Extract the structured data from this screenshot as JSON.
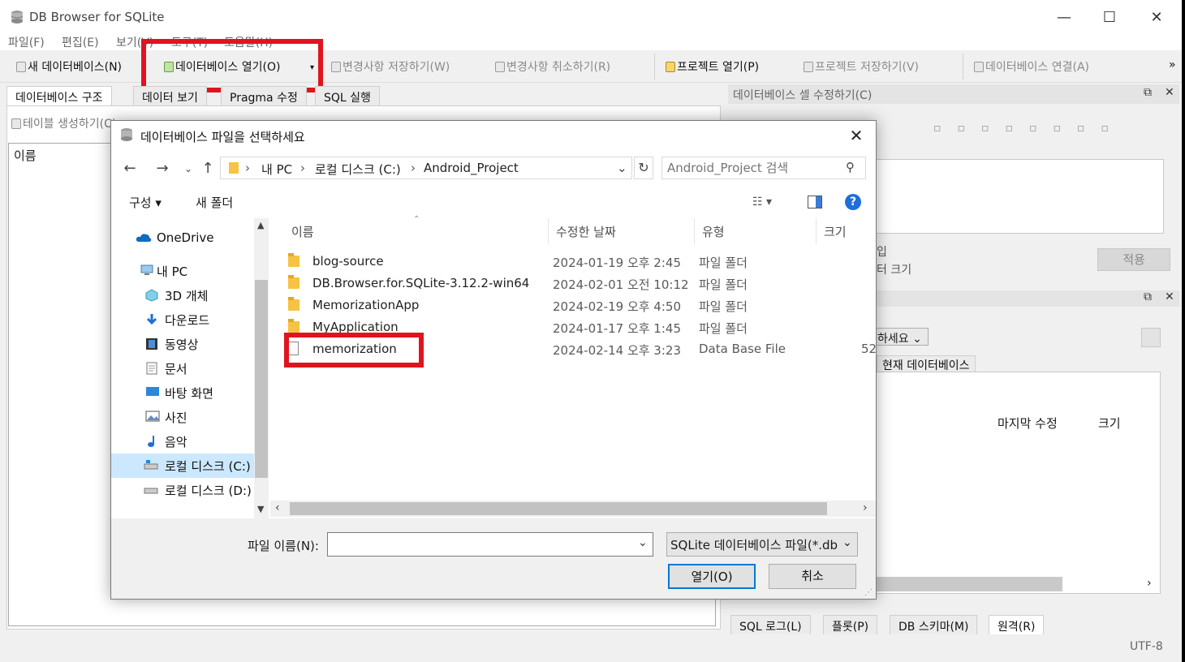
{
  "window": {
    "title": "DB Browser for SQLite",
    "minimize": "—",
    "maximize": "☐",
    "close": "✕"
  },
  "menu": [
    "파일(F)",
    "편집(E)",
    "보기(V)",
    "도구(T)",
    "도움말(H)"
  ],
  "toolbar": {
    "new_db": "새 데이터베이스(N)",
    "open_db": "데이터베이스 열기(O)",
    "write_changes": "변경사항 저장하기(W)",
    "revert_changes": "변경사항 취소하기(R)",
    "open_project": "프로젝트 열기(P)",
    "save_project": "프로젝트 저장하기(V)",
    "attach_db": "데이터베이스 연결(A)",
    "overflow": "»"
  },
  "main_tabs": [
    "데이터베이스 구조",
    "데이터 보기",
    "Pragma 수정",
    "SQL 실행"
  ],
  "structure": {
    "create_table": "테이블 생성하기(C)",
    "column_name": "이름"
  },
  "edit_cell_dock": {
    "title": "데이터베이스 셀 수정하기(C)",
    "type_partial": "입",
    "size_partial": "터 크기",
    "apply_button": "적용"
  },
  "remote_dock": {
    "select_partial": "하세요",
    "current_db_tab": "현재 데이터베이스",
    "last_modified": "마지막 수정",
    "size": "크기"
  },
  "bottom_tabs": [
    "SQL 로그(L)",
    "플롯(P)",
    "DB 스키마(M)",
    "원격(R)"
  ],
  "status": {
    "encoding": "UTF-8"
  },
  "dialog": {
    "title": "데이터베이스 파일을 선택하세요",
    "breadcrumb": [
      "내 PC",
      "로컬 디스크 (C:)",
      "Android_Project"
    ],
    "search_placeholder": "Android_Project 검색",
    "organize": "구성",
    "new_folder": "새 폴더",
    "help": "?",
    "nav_items": [
      {
        "label": "OneDrive",
        "icon": "onedrive-icon"
      },
      {
        "label": "내 PC",
        "icon": "pc-icon"
      },
      {
        "label": "3D 개체",
        "icon": "3d-objects-icon"
      },
      {
        "label": "다운로드",
        "icon": "download-icon"
      },
      {
        "label": "동영상",
        "icon": "video-icon"
      },
      {
        "label": "문서",
        "icon": "document-icon"
      },
      {
        "label": "바탕 화면",
        "icon": "desktop-icon"
      },
      {
        "label": "사진",
        "icon": "picture-icon"
      },
      {
        "label": "음악",
        "icon": "music-icon"
      },
      {
        "label": "로컬 디스크 (C:)",
        "icon": "drive-c-icon"
      },
      {
        "label": "로컬 디스크 (D:)",
        "icon": "drive-d-icon"
      }
    ],
    "columns": [
      "이름",
      "수정한 날짜",
      "유형",
      "크기"
    ],
    "files": [
      {
        "name": "blog-source",
        "date": "2024-01-19 오후 2:45",
        "type": "파일 폴더",
        "size": "",
        "kind": "folder"
      },
      {
        "name": "DB.Browser.for.SQLite-3.12.2-win64",
        "date": "2024-02-01 오전 10:12",
        "type": "파일 폴더",
        "size": "",
        "kind": "folder"
      },
      {
        "name": "MemorizationApp",
        "date": "2024-02-19 오후 4:50",
        "type": "파일 폴더",
        "size": "",
        "kind": "folder"
      },
      {
        "name": "MyApplication",
        "date": "2024-01-17 오후 1:45",
        "type": "파일 폴더",
        "size": "",
        "kind": "folder"
      },
      {
        "name": "memorization",
        "date": "2024-02-14 오후 3:23",
        "type": "Data Base File",
        "size": "52",
        "kind": "file"
      }
    ],
    "filename_label": "파일 이름(N):",
    "filename_value": "",
    "filter": "SQLite 데이터베이스 파일(*.db",
    "open_button": "열기(O)",
    "cancel_button": "취소"
  },
  "colors": {
    "highlight_red": "#e0141e",
    "accent_blue": "#0078d7",
    "help_blue": "#1e6fd9"
  }
}
